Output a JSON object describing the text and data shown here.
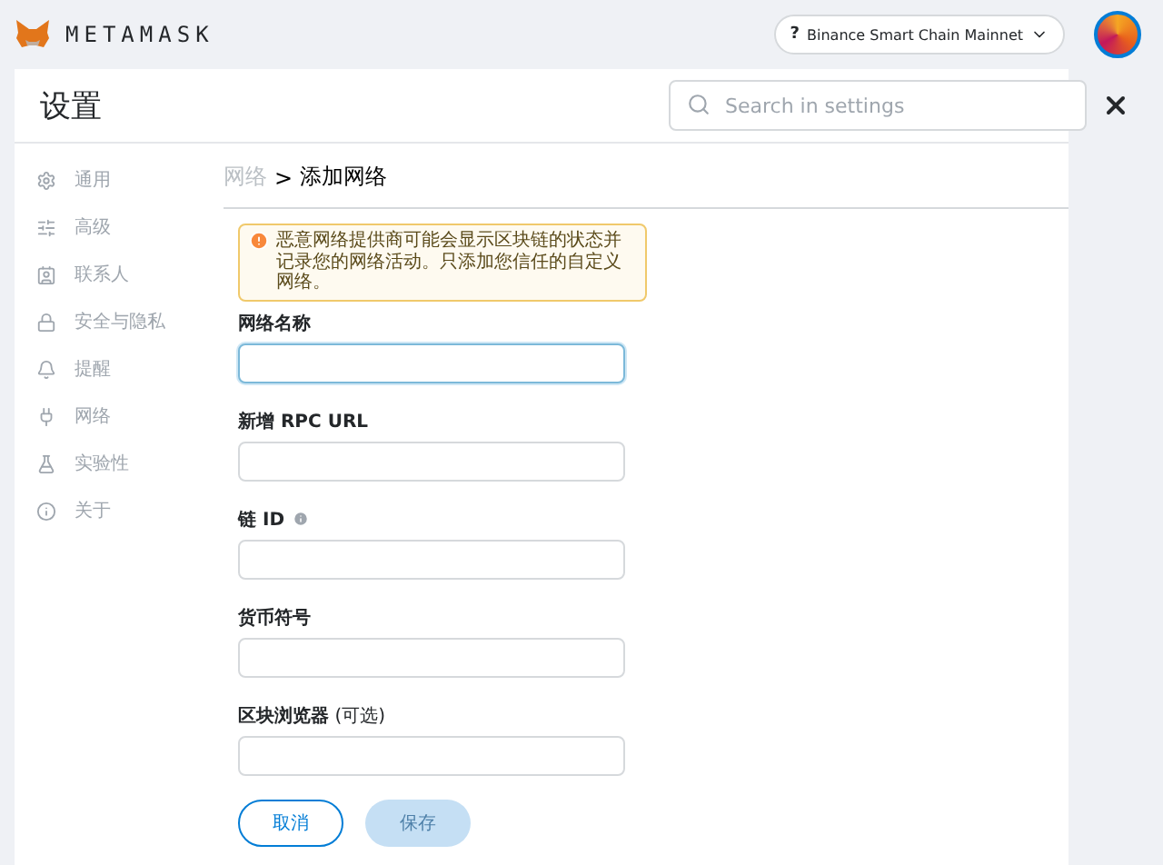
{
  "header": {
    "logo": "METAMASK",
    "network": {
      "icon": "?",
      "name": "Binance Smart Chain Mainnet"
    }
  },
  "settings": {
    "title": "设置",
    "search": {
      "placeholder": "Search in settings"
    }
  },
  "sidebar": {
    "items": [
      {
        "label": "通用"
      },
      {
        "label": "高级"
      },
      {
        "label": "联系人"
      },
      {
        "label": "安全与隐私"
      },
      {
        "label": "提醒"
      },
      {
        "label": "网络"
      },
      {
        "label": "实验性"
      },
      {
        "label": "关于"
      }
    ]
  },
  "breadcrumb": {
    "parent": "网络",
    "separator": ">",
    "current": "添加网络"
  },
  "warning": "恶意网络提供商可能会显示区块链的状态并记录您的网络活动。只添加您信任的自定义网络。",
  "fields": [
    {
      "label": "网络名称",
      "focused": true,
      "info": false
    },
    {
      "label": "新增 RPC URL",
      "focused": false,
      "info": false
    },
    {
      "label": "链 ID",
      "focused": false,
      "info": true
    },
    {
      "label": "货币符号",
      "focused": false,
      "info": false
    },
    {
      "label": "区块浏览器",
      "optional": "(可选)",
      "focused": false,
      "info": false
    }
  ],
  "buttons": [
    {
      "label": "取消",
      "disabled": false,
      "kind": "secondary"
    },
    {
      "label": "保存",
      "disabled": true,
      "kind": "primary"
    }
  ]
}
